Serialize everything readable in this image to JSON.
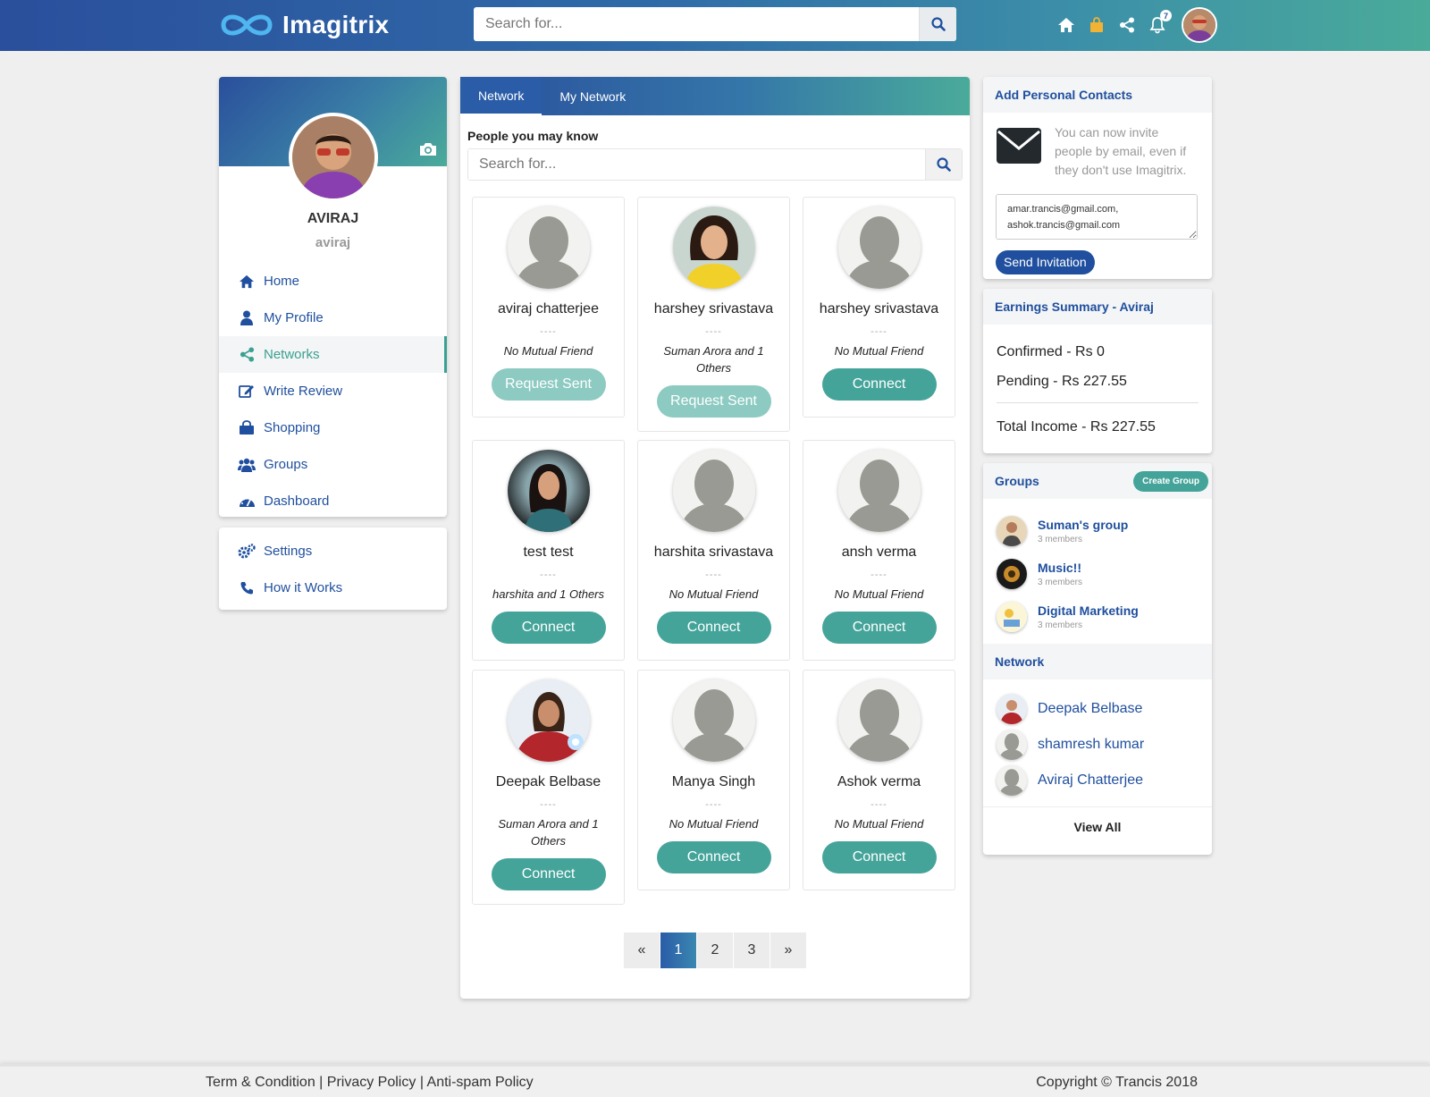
{
  "header": {
    "brand": "Imagitrix",
    "search_placeholder": "Search for...",
    "notification_count": "7"
  },
  "profile": {
    "name": "AVIRAJ",
    "handle": "aviraj"
  },
  "nav": [
    {
      "label": "Home",
      "icon": "home-icon"
    },
    {
      "label": "My Profile",
      "icon": "user-icon"
    },
    {
      "label": "Networks",
      "icon": "share-icon",
      "active": true
    },
    {
      "label": "Write Review",
      "icon": "edit-icon"
    },
    {
      "label": "Shopping",
      "icon": "shopping-bag-icon"
    },
    {
      "label": "Groups",
      "icon": "users-icon"
    },
    {
      "label": "Dashboard",
      "icon": "dashboard-icon"
    }
  ],
  "nav2": [
    {
      "label": "Settings",
      "icon": "cogs-icon"
    },
    {
      "label": "How it Works",
      "icon": "phone-icon"
    }
  ],
  "center": {
    "tabs": [
      "Network",
      "My Network"
    ],
    "section_title": "People you may know",
    "search_placeholder": "Search for...",
    "people": [
      {
        "name": "aviraj chatterjee",
        "dash": "----",
        "mutual": "No Mutual Friend",
        "button": "Request Sent",
        "sent": true,
        "avatar": "placeholder"
      },
      {
        "name": "harshey srivastava",
        "dash": "----",
        "mutual": "Suman Arora and 1 Others",
        "button": "Request Sent",
        "sent": true,
        "avatar": "photo-woman-yellow"
      },
      {
        "name": "harshey srivastava",
        "dash": "----",
        "mutual": "No Mutual Friend",
        "button": "Connect",
        "sent": false,
        "avatar": "placeholder"
      },
      {
        "name": "test test",
        "dash": "----",
        "mutual": "harshita and 1 Others",
        "button": "Connect",
        "sent": false,
        "avatar": "photo-woman-dark"
      },
      {
        "name": "harshita srivastava",
        "dash": "----",
        "mutual": "No Mutual Friend",
        "button": "Connect",
        "sent": false,
        "avatar": "placeholder"
      },
      {
        "name": "ansh verma",
        "dash": "----",
        "mutual": "No Mutual Friend",
        "button": "Connect",
        "sent": false,
        "avatar": "placeholder"
      },
      {
        "name": "Deepak Belbase",
        "dash": "----",
        "mutual": "Suman Arora and 1 Others",
        "button": "Connect",
        "sent": false,
        "avatar": "photo-ironman"
      },
      {
        "name": "Manya Singh",
        "dash": "----",
        "mutual": "No Mutual Friend",
        "button": "Connect",
        "sent": false,
        "avatar": "placeholder"
      },
      {
        "name": "Ashok verma",
        "dash": "----",
        "mutual": "No Mutual Friend",
        "button": "Connect",
        "sent": false,
        "avatar": "placeholder"
      }
    ],
    "pagination": [
      "«",
      "1",
      "2",
      "3",
      "»"
    ],
    "current_page": "1"
  },
  "contacts": {
    "title": "Add Personal Contacts",
    "text": "You can now invite people by email, even if they don't use Imagitrix.",
    "emails_value": "amar.trancis@gmail.com,\nashok.trancis@gmail.com",
    "send_label": "Send Invitation"
  },
  "earnings": {
    "title": "Earnings Summary - Aviraj",
    "confirmed": "Confirmed - Rs 0",
    "pending": "Pending - Rs 227.55",
    "total": "Total Income - Rs 227.55"
  },
  "groups": {
    "title": "Groups",
    "create_label": "Create Group",
    "items": [
      {
        "name": "Suman's group",
        "members": "3 members"
      },
      {
        "name": "Music!!",
        "members": "3 members"
      },
      {
        "name": "Digital Marketing",
        "members": "3 members"
      }
    ]
  },
  "network": {
    "title": "Network",
    "items": [
      {
        "name": "Deepak Belbase"
      },
      {
        "name": "shamresh kumar"
      },
      {
        "name": "Aviraj Chatterjee"
      }
    ],
    "view_all": "View All"
  },
  "footer": {
    "links": [
      "Term & Condition",
      "Privacy Policy",
      "Anti-spam Policy"
    ],
    "separator": "|",
    "copyright": "Copyright © Trancis 2018"
  },
  "colors": {
    "brand_blue": "#1f4f9e",
    "teal": "#45a49a",
    "teal_light": "#8ccac2"
  }
}
